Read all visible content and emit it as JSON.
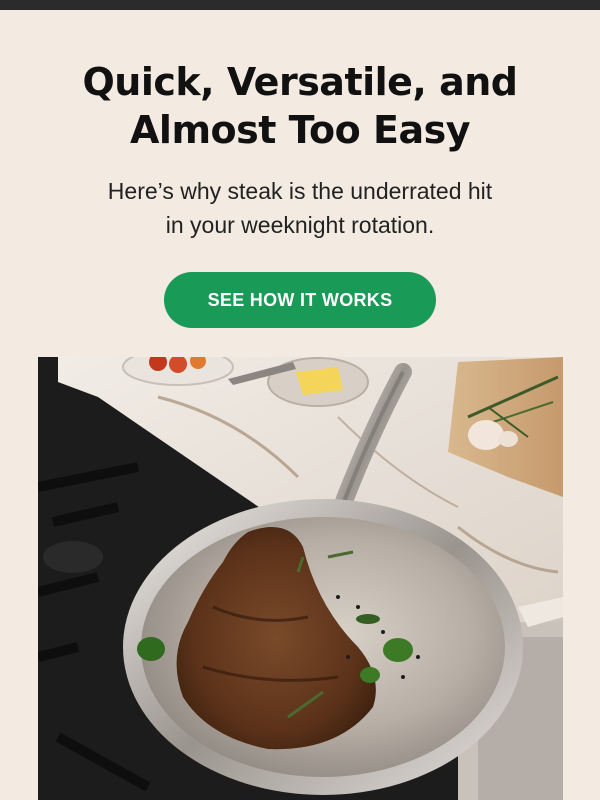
{
  "hero": {
    "title_line1": "Quick, Versatile, and",
    "title_line2": "Almost Too Easy",
    "subtitle_line1": "Here’s why steak is the underrated hit",
    "subtitle_line2": "in your weeknight rotation.",
    "cta_label": "SEE HOW IT WORKS"
  },
  "image": {
    "description_icon": "steak-in-pan-photo"
  },
  "colors": {
    "background": "#f3ebe2",
    "top_bar": "#2b2b2b",
    "cta": "#1a9a57",
    "cta_text": "#ffffff",
    "title": "#111111"
  }
}
